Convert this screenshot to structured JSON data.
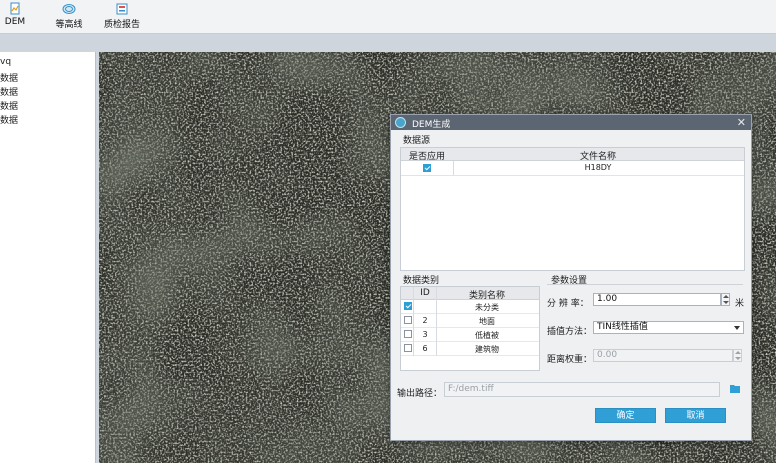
{
  "toolbar": {
    "dem_label": "DEM",
    "contour_label": "等高线",
    "qc_report_label": "质检报告"
  },
  "tree": {
    "items": [
      "vq",
      "数据",
      "数据",
      "数据",
      "数据"
    ]
  },
  "dialog": {
    "title": "DEM生成",
    "close_glyph": "✕",
    "data_source": {
      "section_label": "数据源",
      "col_apply": "是否应用",
      "col_filename": "文件名称",
      "rows": [
        {
          "checked": true,
          "filename": "H18DY"
        }
      ]
    },
    "data_class": {
      "section_label": "数据类别",
      "col_id": "ID",
      "col_name": "类别名称",
      "rows": [
        {
          "checked": true,
          "id": "",
          "name": "未分类"
        },
        {
          "checked": false,
          "id": "2",
          "name": "地面"
        },
        {
          "checked": false,
          "id": "3",
          "name": "低植被"
        },
        {
          "checked": false,
          "id": "6",
          "name": "建筑物"
        }
      ]
    },
    "params": {
      "section_label": "参数设置",
      "resolution_label": "分 辨 率：",
      "resolution_value": "1.00",
      "resolution_unit": "米",
      "interp_label": "插值方法：",
      "interp_value": "TIN线性插值",
      "weight_label": "距离权重：",
      "weight_value": "0.00"
    },
    "output": {
      "label": "输出路径：",
      "value": "F:/dem.tiff"
    },
    "ok_label": "确定",
    "cancel_label": "取消"
  },
  "colors": {
    "accent": "#2f9fd6",
    "title_bar": "#5c6672"
  }
}
